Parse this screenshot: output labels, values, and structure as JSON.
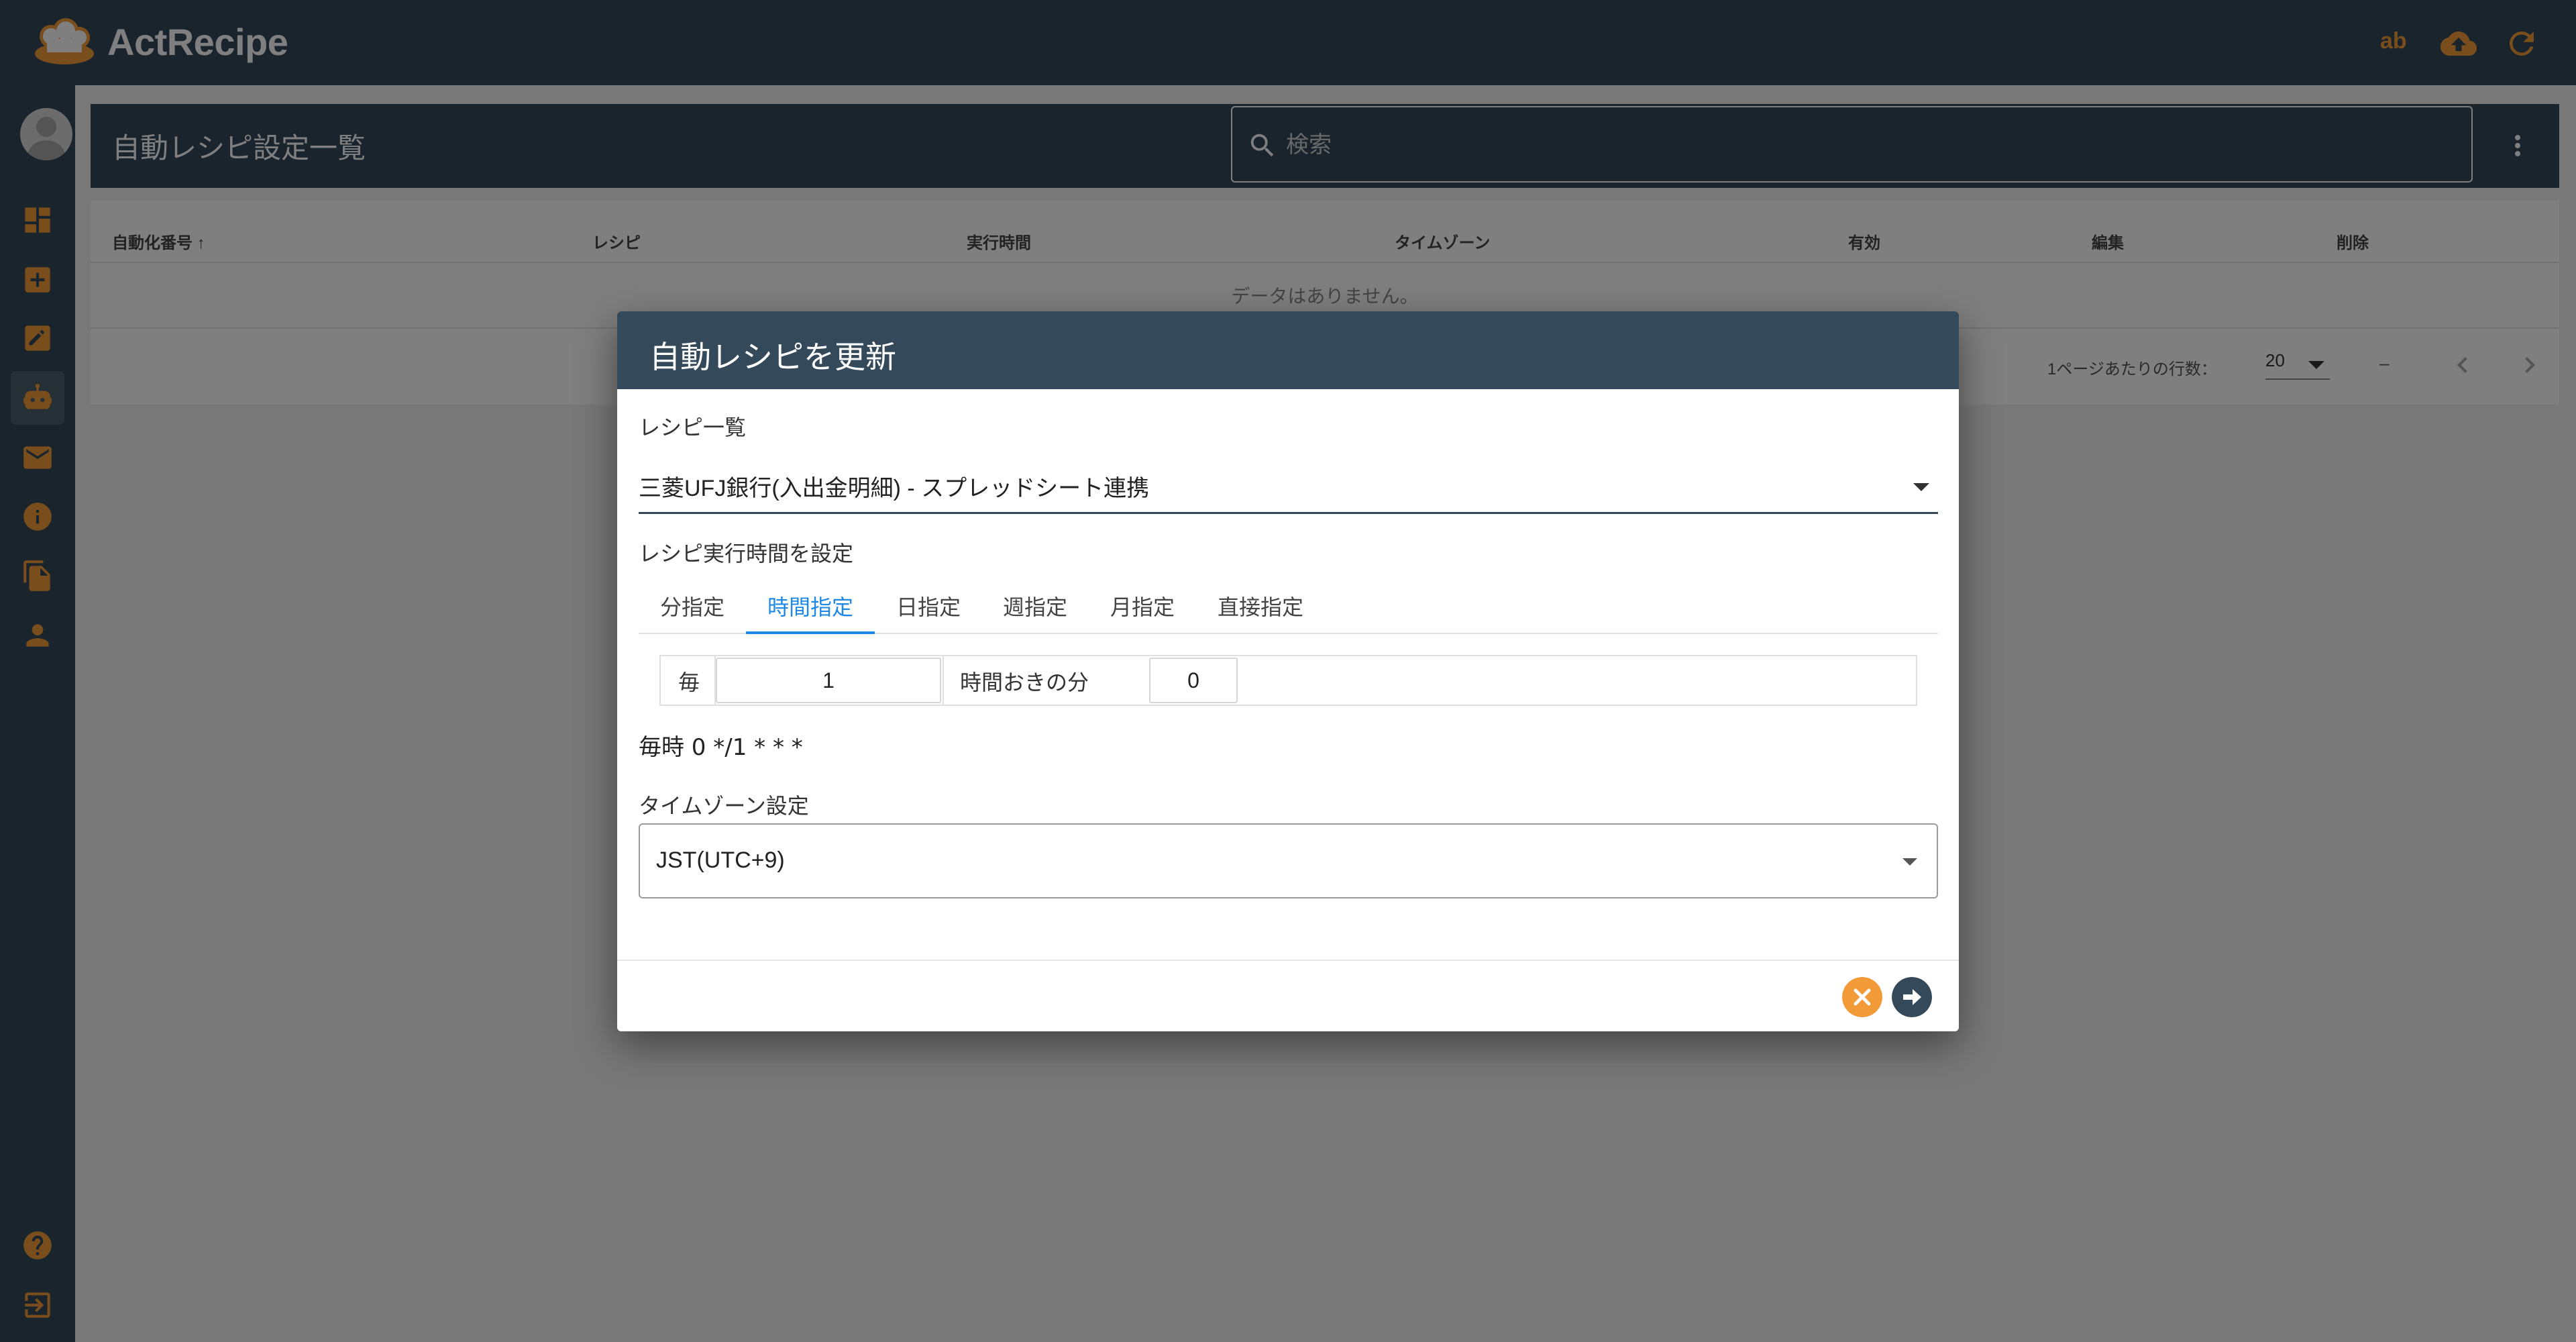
{
  "app": {
    "brand": "ActRecipe",
    "user_initials": "ab",
    "avatar_text": "No image"
  },
  "sidebar": {
    "items": [
      {
        "name": "dashboard-icon"
      },
      {
        "name": "add-box-icon"
      },
      {
        "name": "edit-icon"
      },
      {
        "name": "robot-icon",
        "active": true
      },
      {
        "name": "mail-icon"
      },
      {
        "name": "info-icon"
      },
      {
        "name": "documents-icon"
      },
      {
        "name": "person-icon"
      }
    ],
    "bottom": [
      {
        "name": "help-icon"
      },
      {
        "name": "logout-icon"
      }
    ]
  },
  "panel": {
    "title": "自動レシピ設定一覧",
    "search_placeholder": "検索"
  },
  "table": {
    "columns": [
      "自動化番号",
      "レシピ",
      "実行時間",
      "タイムゾーン",
      "有効",
      "編集",
      "削除"
    ],
    "sort_indicator": "↑",
    "empty_text": "データはありません。",
    "rows_per_page_label": "1ページあたりの行数：",
    "rows_per_page": "20",
    "range_text": "–"
  },
  "dialog": {
    "title": "自動レシピを更新",
    "recipe_list_label": "レシピ一覧",
    "recipe_selected": "三菱UFJ銀行(入出金明細) - スプレッドシート連携",
    "schedule_label": "レシピ実行時間を設定",
    "tabs": [
      "分指定",
      "時間指定",
      "日指定",
      "週指定",
      "月指定",
      "直接指定"
    ],
    "active_tab": "時間指定",
    "cron": {
      "every_label": "毎",
      "hours_value": "1",
      "hours_suffix": "時間おきの分",
      "minute_value": "0"
    },
    "cron_expression": "毎時 0 */1 * * *",
    "timezone_label": "タイムゾーン設定",
    "timezone_value": "JST(UTC+9)"
  },
  "colors": {
    "header_bg": "#34495a",
    "accent_orange": "#f29a38",
    "tab_active": "#1e88e5"
  }
}
